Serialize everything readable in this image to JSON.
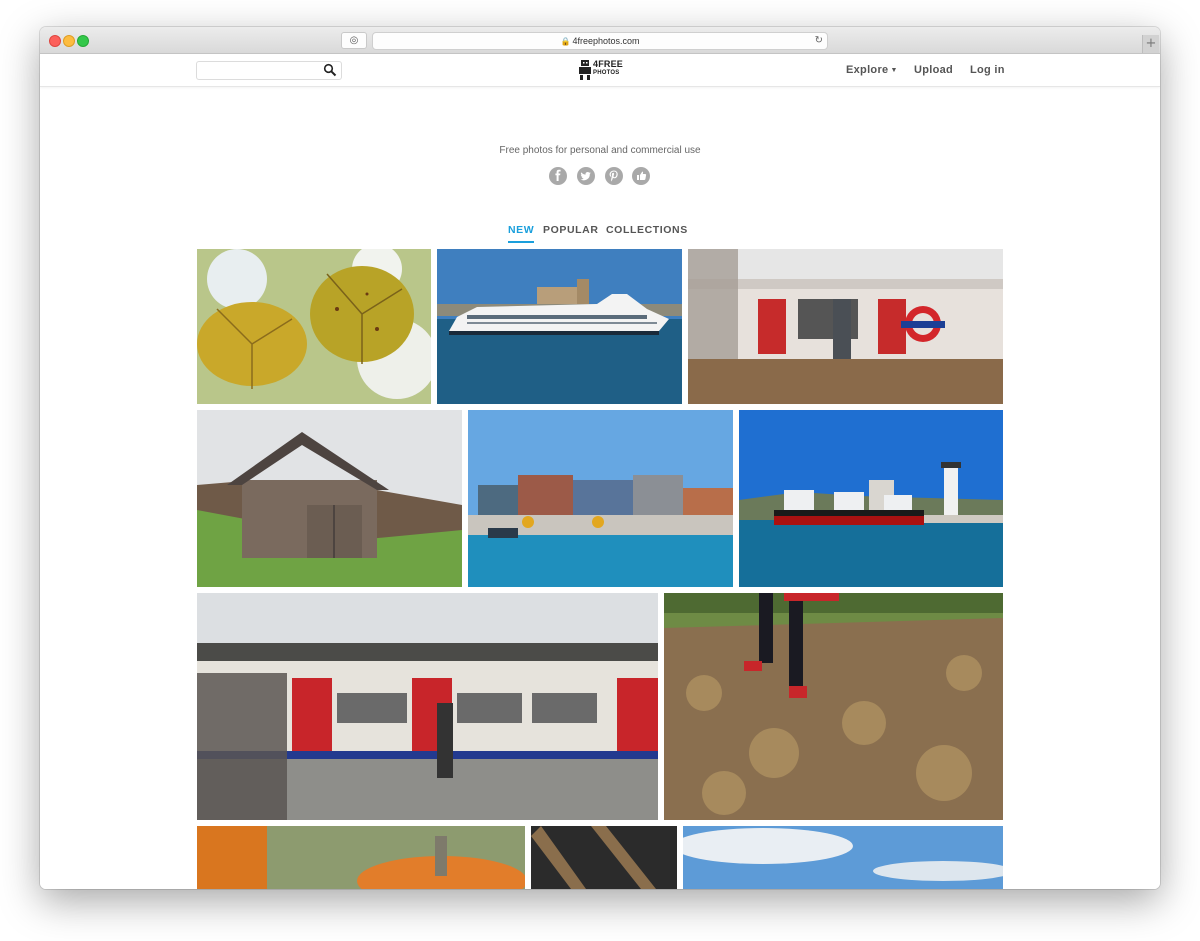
{
  "browser": {
    "url": "4freephotos.com",
    "reader_icon": "reader-icon",
    "reload_icon": "reload-icon",
    "new_tab_icon": "plus-icon"
  },
  "header": {
    "search": {
      "placeholder": "",
      "value": ""
    },
    "logo": {
      "line1": "4FREE",
      "line2": "PHOTOS"
    },
    "nav": {
      "explore": "Explore",
      "upload": "Upload",
      "login": "Log in"
    }
  },
  "tagline": "Free photos for personal and commercial use",
  "social": [
    "facebook-icon",
    "twitter-icon",
    "pinterest-icon",
    "like-icon"
  ],
  "tabs": [
    {
      "label": "NEW",
      "active": true
    },
    {
      "label": "POPULAR",
      "active": false
    },
    {
      "label": "COLLECTIONS",
      "active": false
    }
  ],
  "colors": {
    "accent": "#1a9fdc",
    "text": "#555555"
  },
  "photos": [
    "autumn-leaves-photo",
    "cruise-ship-photo",
    "underground-station-photo",
    "wooden-barn-photo",
    "container-port-photo",
    "tugboats-lighthouse-photo",
    "subway-train-photo",
    "leaves-park-photo",
    "pumpkin-photo",
    "bench-photo",
    "sky-photo"
  ]
}
